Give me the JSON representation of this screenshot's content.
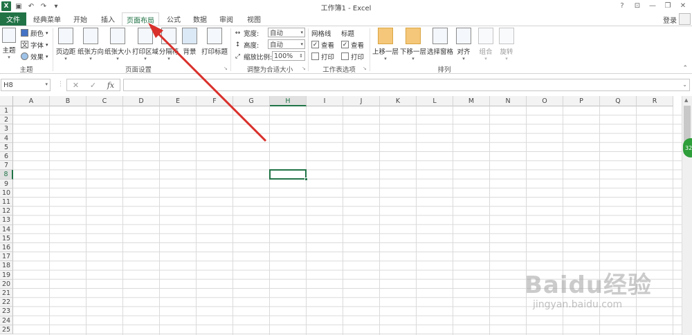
{
  "window": {
    "title": "工作簿1 - Excel",
    "help": "?",
    "login": "登录"
  },
  "tabs": [
    "文件",
    "经典菜单",
    "开始",
    "插入",
    "页面布局",
    "公式",
    "数据",
    "审阅",
    "视图"
  ],
  "active_tab": "页面布局",
  "ribbon": {
    "theme": {
      "label": "主题",
      "button": "主题",
      "colors": "颜色",
      "fonts": "字体",
      "effects": "效果"
    },
    "page_setup": {
      "label": "页面设置",
      "margins": "页边距",
      "orientation": "纸张方向",
      "size": "纸张大小",
      "print_area": "打印区域",
      "breaks": "分隔符",
      "background": "背景",
      "print_titles": "打印标题"
    },
    "scale_to_fit": {
      "label": "调整为合适大小",
      "width_label": "宽度:",
      "width_value": "自动",
      "height_label": "高度:",
      "height_value": "自动",
      "scale_label": "缩放比例:",
      "scale_value": "100%"
    },
    "sheet_options": {
      "label": "工作表选项",
      "gridlines": "网格线",
      "headings": "标题",
      "view": "查看",
      "print": "打印"
    },
    "arrange": {
      "label": "排列",
      "bring_forward": "上移一层",
      "send_backward": "下移一层",
      "selection_pane": "选择窗格",
      "align": "对齐",
      "group": "组合",
      "rotate": "旋转"
    }
  },
  "formula_bar": {
    "name_box": "H8",
    "fx": "fx"
  },
  "grid": {
    "columns": [
      "A",
      "B",
      "C",
      "D",
      "E",
      "F",
      "G",
      "H",
      "I",
      "J",
      "K",
      "L",
      "M",
      "N",
      "O",
      "P",
      "Q",
      "R"
    ],
    "rows": [
      "1",
      "2",
      "3",
      "4",
      "5",
      "6",
      "7",
      "8",
      "9",
      "10",
      "11",
      "12",
      "13",
      "14",
      "15",
      "16",
      "17",
      "18",
      "19",
      "20",
      "21",
      "22",
      "23",
      "24",
      "25"
    ],
    "selected_column": "H",
    "selected_row": "8"
  },
  "float_badge": "32",
  "watermark": {
    "main": "Baidu经验",
    "sub": "jingyan.baidu.com"
  },
  "colors": {
    "excel_green": "#217346",
    "arrow_red": "#d9302b"
  }
}
